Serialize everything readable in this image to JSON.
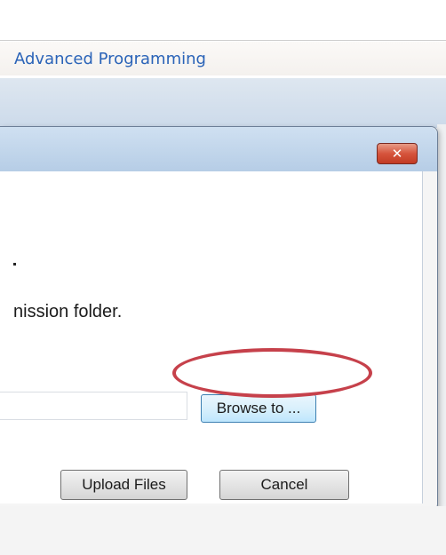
{
  "page": {
    "breadcrumb": "Advanced Programming"
  },
  "dialog": {
    "close_label": "✕",
    "message": "nission folder.",
    "path_value": "",
    "browse_label": "Browse to ...",
    "upload_label": "Upload Files",
    "cancel_label": "Cancel"
  },
  "colors": {
    "highlight": "#c6414b",
    "link": "#2a63b8"
  }
}
